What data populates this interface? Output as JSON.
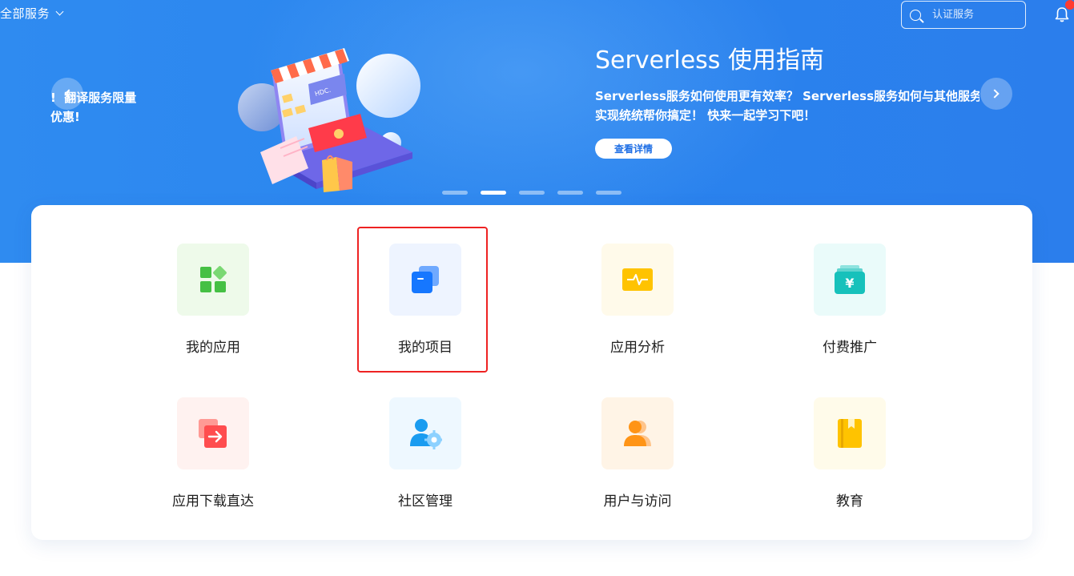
{
  "header": {
    "all_services_label": "全部服务",
    "search_placeholder": "认证服务"
  },
  "banner": {
    "left_promo_text": "! 翻译服务限量\n优惠!",
    "illustration_text": "HDC Together",
    "title": "Serverless 使用指南",
    "description": "Serverless服务如何使用更有效率？ Serverless服务如何与其他服务组合\n实现统统帮你搞定！ 快来一起学习下吧！",
    "cta_label": "查看详情",
    "slide_count": 5,
    "active_slide": 2
  },
  "services": [
    {
      "label": "我的应用",
      "icon": "grid-apps-icon",
      "tile_color": "#eefaea"
    },
    {
      "label": "我的项目",
      "icon": "project-folders-icon",
      "tile_color": "#eef4ff"
    },
    {
      "label": "应用分析",
      "icon": "analytics-monitor-icon",
      "tile_color": "#fffaea"
    },
    {
      "label": "付费推广",
      "icon": "paid-promotion-yuan-icon",
      "tile_color": "#eafbfa"
    },
    {
      "label": "应用下载直达",
      "icon": "download-direct-icon",
      "tile_color": "#fff2f0"
    },
    {
      "label": "社区管理",
      "icon": "community-user-gear-icon",
      "tile_color": "#eef8ff"
    },
    {
      "label": "用户与访问",
      "icon": "users-access-icon",
      "tile_color": "#fff4e6"
    },
    {
      "label": "教育",
      "icon": "education-book-icon",
      "tile_color": "#fffbea"
    }
  ],
  "colors": {
    "banner_blue": "#2b86ee",
    "highlight_red": "#ee2222",
    "green": "#4cc14c",
    "blue": "#1677ff",
    "yellow": "#ffc300",
    "teal": "#1cc3be",
    "red": "#ff4d4f",
    "orange": "#ff9b13"
  }
}
